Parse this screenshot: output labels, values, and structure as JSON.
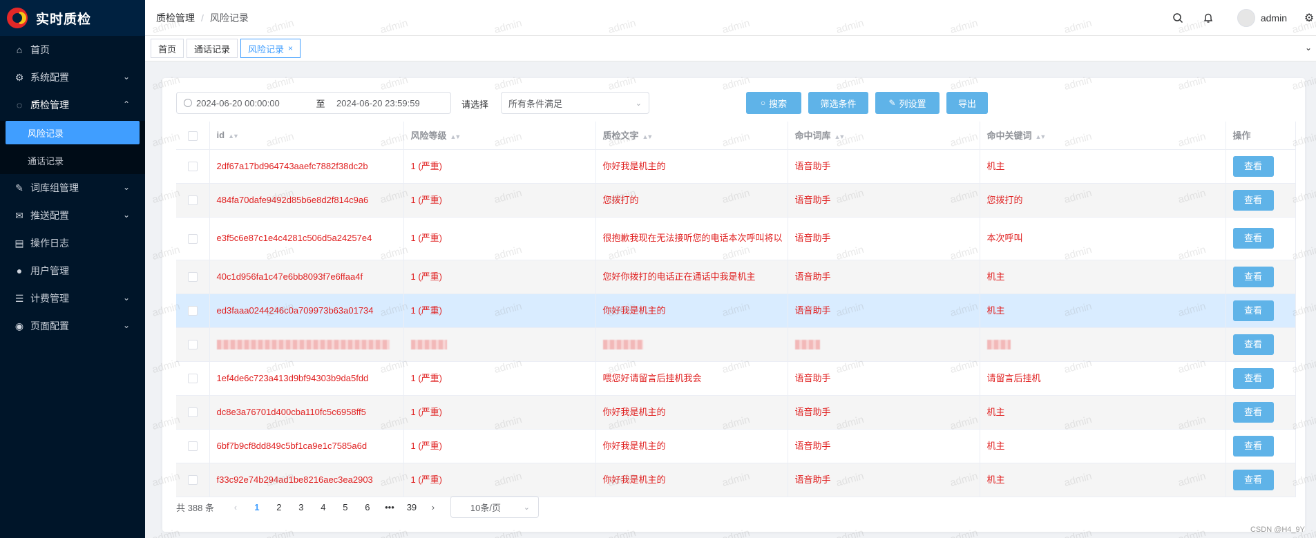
{
  "app": {
    "title": "实时质检"
  },
  "sidebar": {
    "items": [
      {
        "label": "首页",
        "icon": "home-icon"
      },
      {
        "label": "系统配置",
        "icon": "gear-icon"
      },
      {
        "label": "质检管理",
        "icon": "chat-icon"
      },
      {
        "label": "词库组管理",
        "icon": "edit-icon"
      },
      {
        "label": "推送配置",
        "icon": "mail-icon"
      },
      {
        "label": "操作日志",
        "icon": "document-icon"
      },
      {
        "label": "用户管理",
        "icon": "user-icon"
      },
      {
        "label": "计费管理",
        "icon": "database-icon"
      },
      {
        "label": "页面配置",
        "icon": "chrome-icon"
      }
    ],
    "sub_items": [
      {
        "label": "风险记录"
      },
      {
        "label": "通话记录"
      }
    ]
  },
  "header": {
    "breadcrumb": [
      "质检管理",
      "风险记录"
    ],
    "breadcrumb_sep": "/",
    "username": "admin"
  },
  "tabs": [
    {
      "label": "首页"
    },
    {
      "label": "通话记录"
    },
    {
      "label": "风险记录",
      "close": "×"
    }
  ],
  "filters": {
    "date_start": "2024-06-20 00:00:00",
    "date_sep": "至",
    "date_end": "2024-06-20 23:59:59",
    "select_label": "请选择",
    "select_value": "所有条件满足",
    "search_label": "搜索",
    "filter_label": "筛选条件",
    "columns_label": "列设置",
    "export_label": "导出"
  },
  "table": {
    "headers": [
      "id",
      "风险等级",
      "质检文字",
      "命中词库",
      "命中关键词",
      "操作"
    ],
    "rows": [
      {
        "id": "2df67a17bd964743aaefc7882f38dc2b",
        "level": "1 (严重)",
        "text": "你好我是机主的",
        "lib": "语音助手",
        "kw": "机主",
        "action": "查看"
      },
      {
        "id": "484fa70dafe9492d85b6e8d2f814c9a6",
        "level": "1 (严重)",
        "text": "您拨打的",
        "lib": "语音助手",
        "kw": "您拨打的",
        "action": "查看"
      },
      {
        "id": "e3f5c6e87c1e4c4281c506d5a24257e4",
        "level": "1 (严重)",
        "text": "很抱歉我现在无法接听您的电话本次呼叫将以",
        "lib": "语音助手",
        "kw": "本次呼叫",
        "action": "查看"
      },
      {
        "id": "40c1d956fa1c47e6bb8093f7e6ffaa4f",
        "level": "1 (严重)",
        "text": "您好你拨打的电话正在通话中我是机主",
        "lib": "语音助手",
        "kw": "机主",
        "action": "查看"
      },
      {
        "id": "ed3faaa0244246c0a709973b63a01734",
        "level": "1 (严重)",
        "text": "你好我是机主的",
        "lib": "语音助手",
        "kw": "机主",
        "action": "查看"
      },
      {
        "id": "",
        "level": "",
        "text": "",
        "lib": "",
        "kw": "",
        "action": "查看"
      },
      {
        "id": "1ef4de6c723a413d9bf94303b9da5fdd",
        "level": "1 (严重)",
        "text": "喂您好请留言后挂机我会",
        "lib": "语音助手",
        "kw": "请留言后挂机",
        "action": "查看"
      },
      {
        "id": "dc8e3a76701d400cba110fc5c6958ff5",
        "level": "1 (严重)",
        "text": "你好我是机主的",
        "lib": "语音助手",
        "kw": "机主",
        "action": "查看"
      },
      {
        "id": "6bf7b9cf8dd849c5bf1ca9e1c7585a6d",
        "level": "1 (严重)",
        "text": "你好我是机主的",
        "lib": "语音助手",
        "kw": "机主",
        "action": "查看"
      },
      {
        "id": "f33c92e74b294ad1be8216aec3ea2903",
        "level": "1 (严重)",
        "text": "你好我是机主的",
        "lib": "语音助手",
        "kw": "机主",
        "action": "查看"
      }
    ]
  },
  "pagination": {
    "total": "共 388 条",
    "pages": [
      "1",
      "2",
      "3",
      "4",
      "5",
      "6",
      "•••",
      "39"
    ],
    "current": "1",
    "page_size": "10条/页"
  },
  "watermark": {
    "text": "admin",
    "credit": "CSDN @H4_9Y"
  },
  "colors": {
    "sidebar_bg": "#001529",
    "accent": "#409eff",
    "button": "#5fb3e8",
    "danger_text": "#e02020",
    "highlight_row": "#d9ecff"
  }
}
